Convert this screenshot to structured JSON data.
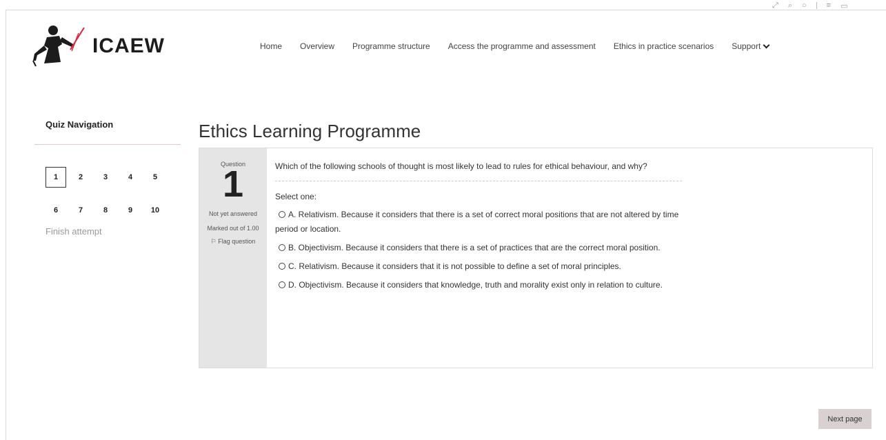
{
  "header": {
    "logo_text": "ICAEW",
    "nav": [
      {
        "label": "Home"
      },
      {
        "label": "Overview"
      },
      {
        "label": "Programme structure"
      },
      {
        "label": "Access the programme and assessment"
      },
      {
        "label": "Ethics in practice scenarios"
      },
      {
        "label": "Support"
      }
    ]
  },
  "quiz_nav": {
    "title": "Quiz Navigation",
    "questions": [
      "1",
      "2",
      "3",
      "4",
      "5",
      "6",
      "7",
      "8",
      "9",
      "10"
    ],
    "current": "1",
    "finish_label": "Finish attempt"
  },
  "page": {
    "title": "Ethics Learning Programme"
  },
  "question": {
    "label": "Question",
    "number": "1",
    "state": "Not yet answered",
    "marks": "Marked out of 1.00",
    "flag_label": "Flag question",
    "text": "Which of the following schools of thought is most likely to lead to rules for ethical behaviour, and why?",
    "prompt": "Select one:",
    "options": [
      {
        "text": "A. Relativism. Because it considers that there is a set of correct moral positions that are not altered by time period or location."
      },
      {
        "text": "B. Objectivism. Because it considers that there is a set of practices that are the correct moral position."
      },
      {
        "text": "C. Relativism. Because it considers that it is not possible to define a set of moral principles."
      },
      {
        "text": "D. Objectivism. Because it considers that knowledge, truth and morality exist only in relation to culture."
      }
    ]
  },
  "footer": {
    "next_label": "Next page"
  },
  "colors": {
    "accent_red": "#d7263d",
    "nav_divider": "#e4c9cf",
    "button_bg": "#d8d0d1",
    "info_bg": "#e5e5e5"
  }
}
